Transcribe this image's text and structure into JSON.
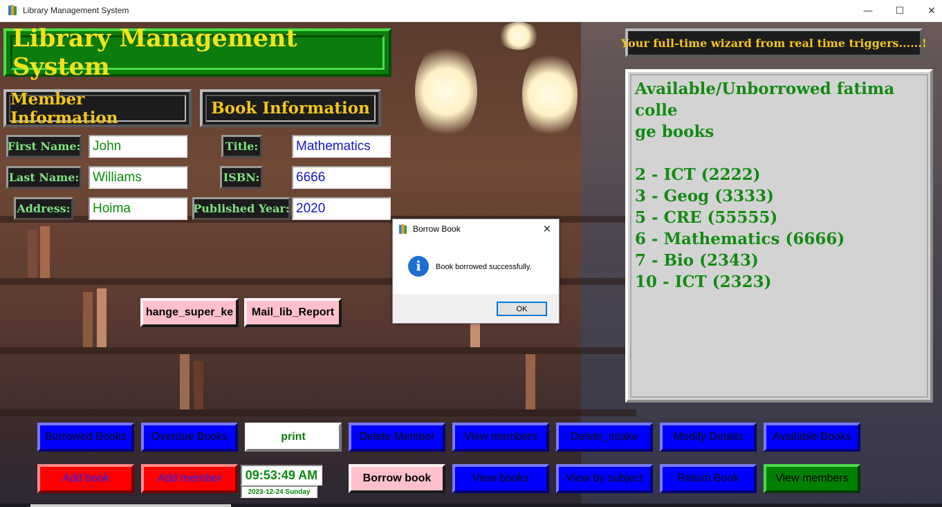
{
  "window": {
    "title": "Library Management System",
    "controls": {
      "minimize": "—",
      "maximize": "☐",
      "close": "✕"
    }
  },
  "header": {
    "app_title": "Library Management System",
    "tagline": "Your full-time wizard from real time triggers......!"
  },
  "member_section": {
    "title": "Member Information",
    "fields": [
      {
        "label": "First Name:",
        "value": "John"
      },
      {
        "label": "Last Name:",
        "value": "Williams"
      },
      {
        "label": "Address:",
        "value": "Hoima"
      }
    ]
  },
  "book_section": {
    "title": "Book Information",
    "fields": [
      {
        "label": "Title:",
        "value": "Mathematics"
      },
      {
        "label": "ISBN:",
        "value": "6666"
      },
      {
        "label": "Published Year:",
        "value": "2020"
      }
    ]
  },
  "extra_buttons": {
    "change_super_key": "hange_super_ke",
    "mail_report": "Mail_lib_Report"
  },
  "available_list": {
    "heading_line1": "Available/Unborrowed fatima colle",
    "heading_line2": "ge books",
    "items": [
      "2 - ICT (2222)",
      "3 - Geog (3333)",
      "5 - CRE (55555)",
      "6 - Mathematics (6666)",
      "7 - Bio (2343)",
      "10 - ICT (2323)"
    ]
  },
  "dialog": {
    "title": "Borrow Book",
    "icon": "info-icon",
    "message": "Book borrowed successfully.",
    "ok_label": "OK",
    "close": "✕"
  },
  "buttons_row1": [
    "Borrowed Books",
    "Overdue Books",
    "print",
    "Delete Member",
    "View members",
    "Delete_intake",
    "Modify Details",
    "Available Books"
  ],
  "buttons_row2": {
    "add_book": "Add book",
    "add_member": "Add member",
    "borrow_book": "Borrow book",
    "view_books": "View books",
    "view_by_subject": "View by subject",
    "return_book": "Return Book",
    "view_members": "View members"
  },
  "clock": {
    "time": "09:53:49 AM",
    "date": "2023-12-24 Sunday"
  },
  "colors": {
    "title_green": "#0c7c0c",
    "title_text": "#f3e21a",
    "label_text": "#7fe27f",
    "list_bg": "#d3d3d3",
    "list_text": "#138a13",
    "button_blue": "#0000ff",
    "button_red": "#ff0000",
    "button_pink": "#ffc0cb",
    "button_green": "#008000"
  }
}
